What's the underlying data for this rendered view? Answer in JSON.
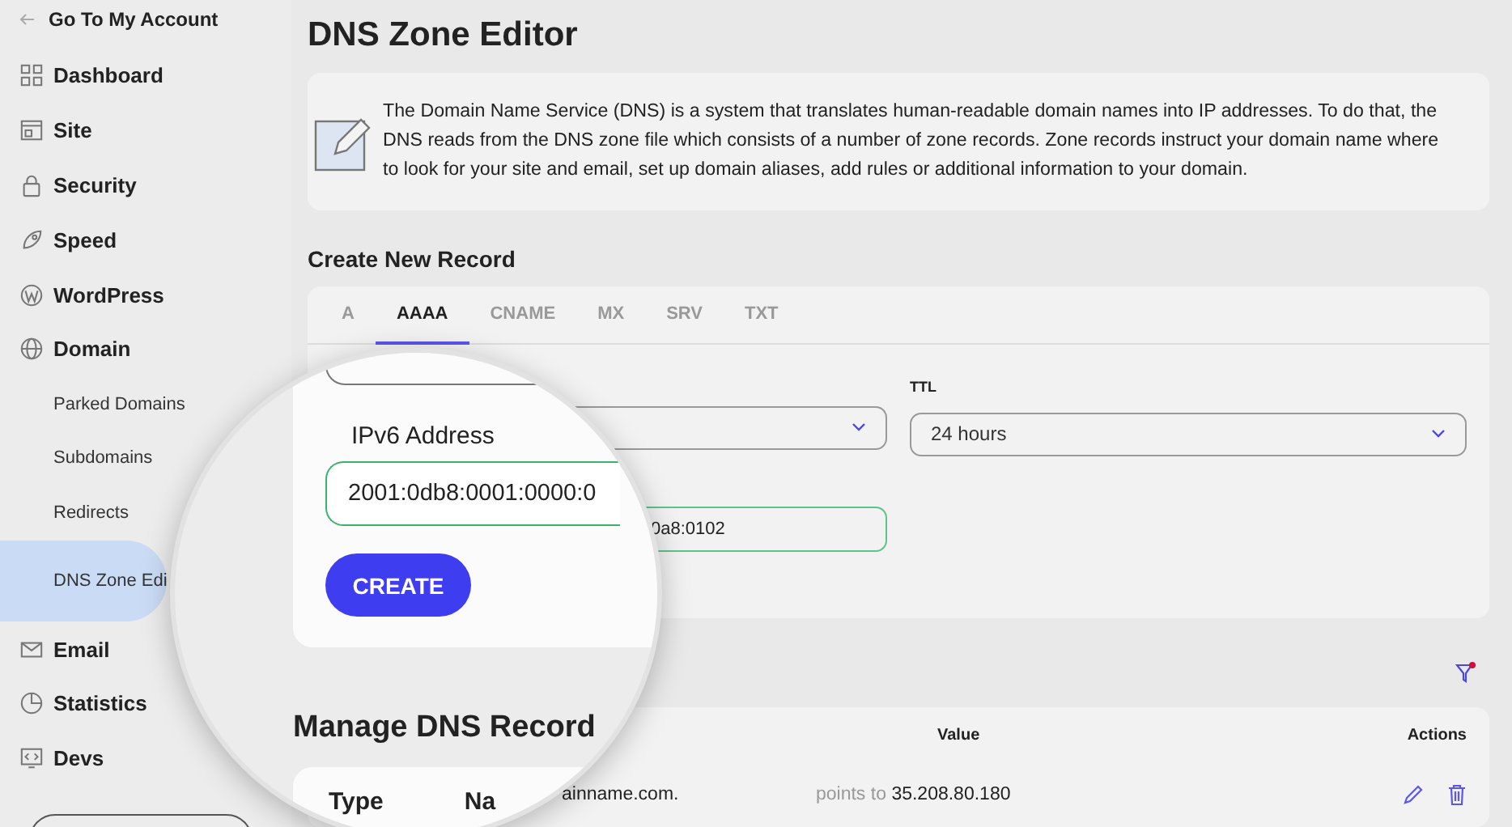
{
  "sidebar": {
    "back_link": "Go To My Account",
    "items": [
      {
        "label": "Dashboard",
        "selected": false
      },
      {
        "label": "Site",
        "selected": false
      },
      {
        "label": "Security",
        "selected": false
      },
      {
        "label": "Speed",
        "selected": false
      },
      {
        "label": "WordPress",
        "selected": false
      },
      {
        "label": "Domain",
        "selected": false,
        "children": [
          {
            "label": "Parked Domains",
            "selected": false
          },
          {
            "label": "Subdomains",
            "selected": false
          },
          {
            "label": "Redirects",
            "selected": false
          },
          {
            "label": "DNS Zone Edi",
            "selected": true
          }
        ]
      },
      {
        "label": "Email",
        "selected": false
      },
      {
        "label": "Statistics",
        "selected": false
      },
      {
        "label": "Devs",
        "selected": false
      }
    ]
  },
  "page_title": "DNS Zone Editor",
  "info": "The Domain Name Service (DNS) is a system that translates human-readable domain names into IP addresses. To do that, the DNS reads from the DNS zone file which consists of a number of zone records. Zone records instruct your domain name where to look for your site and email, set up domain aliases, add rules or additional information to your domain.",
  "create_record": {
    "title": "Create New Record",
    "tabs": [
      {
        "label": "A",
        "selected": false
      },
      {
        "label": "AAAA",
        "selected": true
      },
      {
        "label": "CNAME",
        "selected": false
      },
      {
        "label": "MX",
        "selected": false
      },
      {
        "label": "SRV",
        "selected": false
      },
      {
        "label": "TXT",
        "selected": false
      }
    ],
    "ttl_label": "TTL",
    "ttl_value": "24 hours",
    "address_value": "0a8:0102"
  },
  "magnifier": {
    "address_label": "IPv6 Address",
    "address_value": "2001:0db8:0001:0000:0",
    "create_button": "CREATE",
    "manage_title": "Manage DNS Record",
    "column_1": "Type",
    "column_2": "Na"
  },
  "records": {
    "columns": [
      "Value",
      "Actions"
    ],
    "rows": [
      {
        "name": "ainname.com.",
        "value_prefix": "points to",
        "value": "35.208.80.180"
      }
    ]
  }
}
